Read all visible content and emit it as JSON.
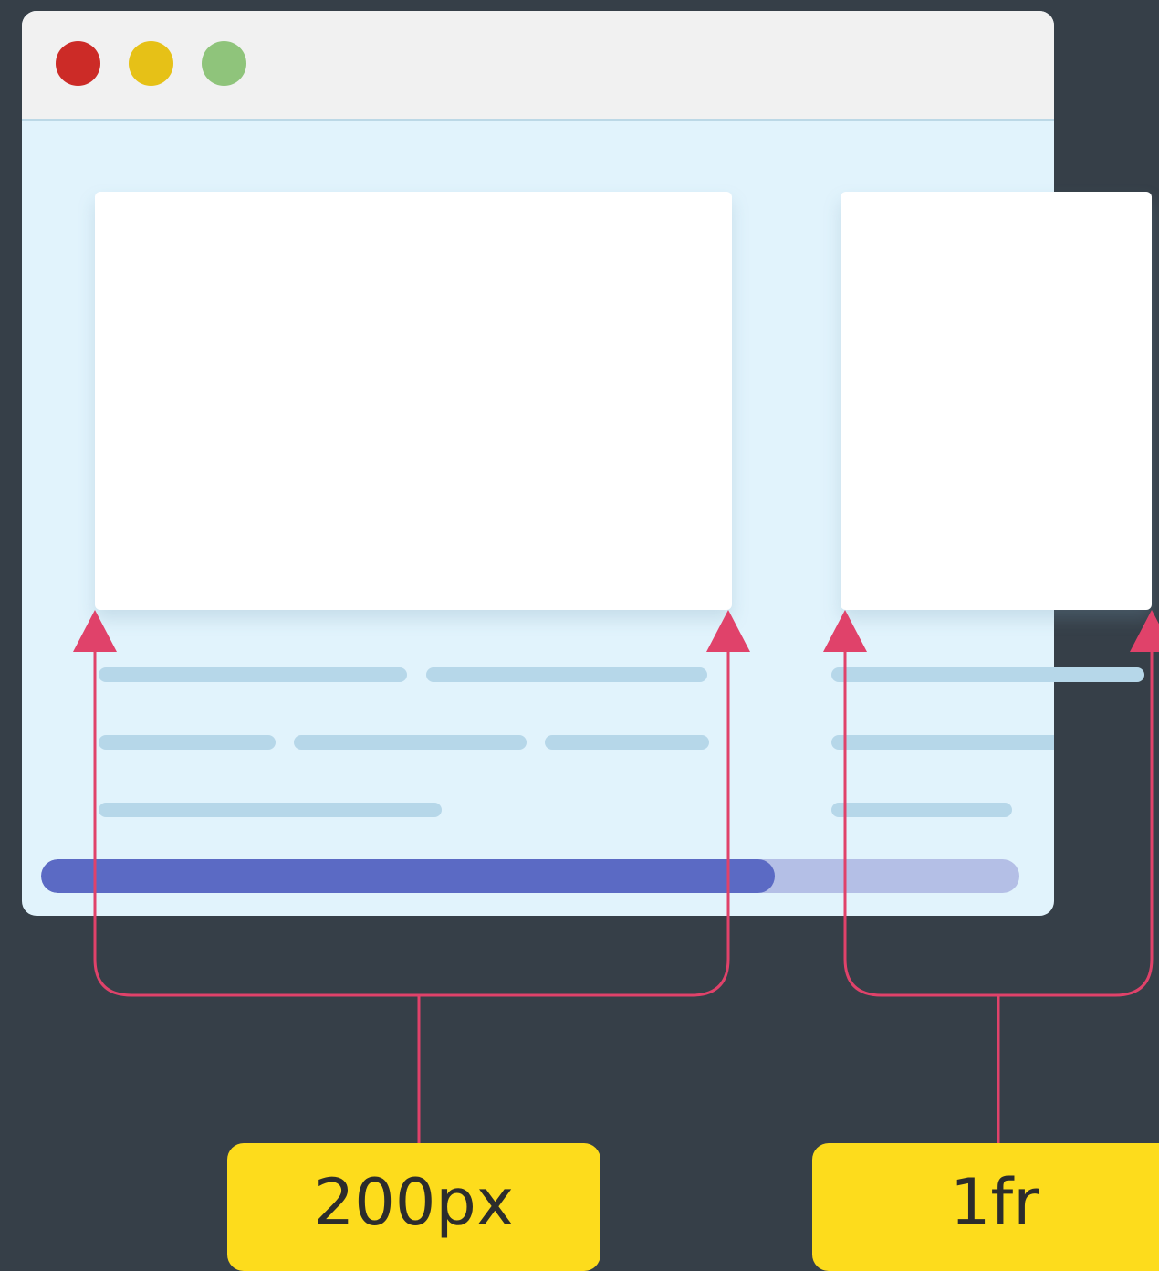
{
  "colors": {
    "close_dot": "#cc2b27",
    "minimize_dot": "#e6c117",
    "maximize_dot": "#8fc47b",
    "annotation": "#e0426a",
    "label_bg": "#fddc1c",
    "progress_fill": "#5b6ac4",
    "progress_track": "#b4bfe6"
  },
  "icons": [
    "close-dot",
    "minimize-dot",
    "maximize-dot",
    "arrow-up-icon"
  ],
  "progress": {
    "fraction": 0.75
  },
  "labels": {
    "first_column": "200px",
    "second_column": "1fr"
  }
}
